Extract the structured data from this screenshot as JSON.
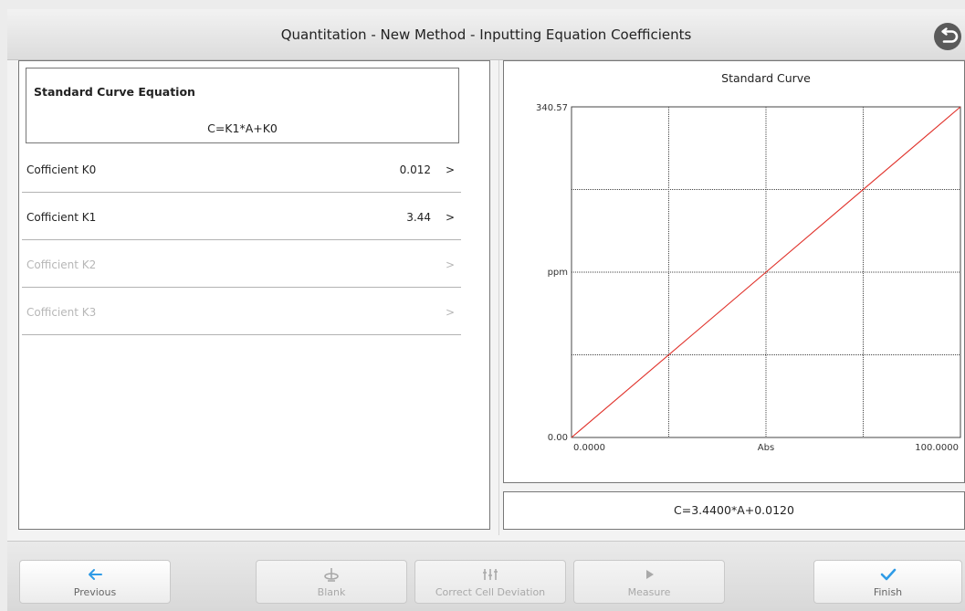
{
  "header": {
    "title": "Quantitation - New Method - Inputting Equation Coefficients",
    "back_icon": "back-return-icon"
  },
  "equation": {
    "title": "Standard Curve Equation",
    "formula": "C=K1*A+K0"
  },
  "coefficients": [
    {
      "label": "Cofficient K0",
      "value": "0.012",
      "arrow": ">",
      "enabled": true
    },
    {
      "label": "Cofficient K1",
      "value": "3.44",
      "arrow": ">",
      "enabled": true
    },
    {
      "label": "Cofficient K2",
      "value": "",
      "arrow": ">",
      "enabled": false
    },
    {
      "label": "Cofficient K3",
      "value": "",
      "arrow": ">",
      "enabled": false
    }
  ],
  "chart_data": {
    "type": "line",
    "title": "Standard Curve",
    "xlabel": "Abs",
    "ylabel": "ppm",
    "xlim": [
      0,
      100
    ],
    "ylim": [
      0,
      340.57
    ],
    "x_tick_labels": [
      "0.0000",
      "100.0000"
    ],
    "y_tick_labels": [
      "0.00",
      "340.57"
    ],
    "grid": true,
    "grid_divisions": 4,
    "series": [
      {
        "color": "#e0312a",
        "x": [
          0,
          100
        ],
        "y": [
          0,
          340.57
        ]
      }
    ]
  },
  "fit_equation": "C=3.4400*A+0.0120",
  "toolbar": {
    "previous": {
      "label": "Previous",
      "icon": "arrow-left-icon",
      "enabled": true
    },
    "blank": {
      "label": "Blank",
      "icon": "blank-cell-icon",
      "enabled": false
    },
    "correct": {
      "label": "Correct Cell Deviation",
      "icon": "cell-deviation-icon",
      "enabled": false
    },
    "measure": {
      "label": "Measure",
      "icon": "play-icon",
      "enabled": false
    },
    "finish": {
      "label": "Finish",
      "icon": "check-icon",
      "enabled": true
    }
  },
  "colors": {
    "accent": "#2f9be6",
    "curve": "#e0312a",
    "disabled_text": "#b7b7b7"
  }
}
